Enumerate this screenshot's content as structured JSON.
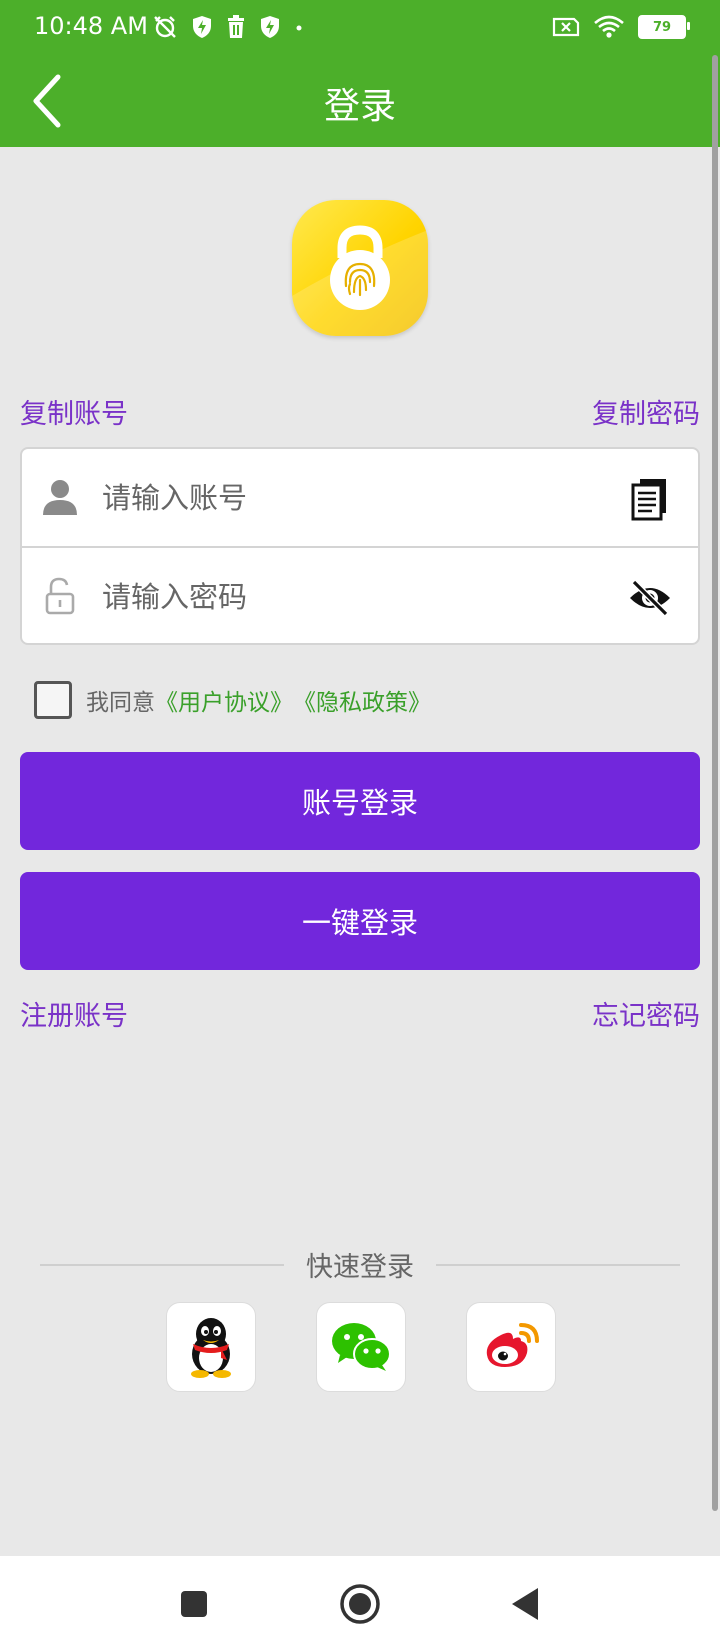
{
  "status_bar": {
    "time": "10:48 AM",
    "battery": "79",
    "left_icons": [
      "alarm-off-icon",
      "shield-bolt-icon",
      "trash-icon",
      "shield-bolt-icon",
      "dot-icon"
    ],
    "right_icons": [
      "sim-x-icon",
      "wifi-icon",
      "battery-icon"
    ]
  },
  "app_bar": {
    "title": "登录",
    "back_icon": "chevron-left-icon",
    "color": "#4caf2a"
  },
  "logo": {
    "icon": "fingerprint-lock-icon"
  },
  "links": {
    "copy_account": "复制账号",
    "copy_password": "复制密码",
    "register": "注册账号",
    "forgot_password": "忘记密码"
  },
  "form": {
    "account": {
      "placeholder": "请输入账号",
      "value": "",
      "icon": "user-icon",
      "action_icon": "clipboard-icon"
    },
    "password": {
      "placeholder": "请输入密码",
      "value": "",
      "icon": "lock-icon",
      "action_icon": "eye-off-icon"
    }
  },
  "agreement": {
    "prefix": "我同意",
    "user_agreement": "《用户协议》",
    "privacy_policy": "《隐私政策》",
    "checked": false
  },
  "buttons": {
    "account_login": "账号登录",
    "one_key_login": "一键登录",
    "color": "#7227dc"
  },
  "quick_login": {
    "label": "快速登录",
    "providers": [
      "qq-icon",
      "wechat-icon",
      "weibo-icon"
    ]
  },
  "nav_bar": {
    "icons": [
      "recent-apps-icon",
      "home-icon",
      "back-icon"
    ]
  }
}
